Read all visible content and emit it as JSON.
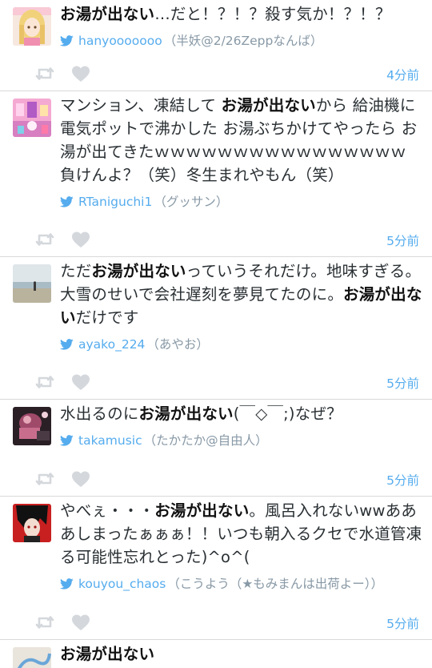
{
  "colors": {
    "link": "#55acee",
    "meta": "#8899a6",
    "icon_gray": "#d4d8dc",
    "divider": "#d9d9d9"
  },
  "tweets": [
    {
      "avatar": "anime-girl-blonde-avatar",
      "segments": [
        {
          "text": "お湯が出ない",
          "bold": true
        },
        {
          "text": "…だと！？！？殺す気か！？！？",
          "bold": false
        }
      ],
      "screen_name": "hanyooooooo",
      "display_name": "（半妖@2/26Zeppなんば）",
      "time": "4分前"
    },
    {
      "avatar": "pink-room-avatar",
      "segments": [
        {
          "text": "マンション、凍結して ",
          "bold": false
        },
        {
          "text": "お湯が出ない",
          "bold": true
        },
        {
          "text": "から 給油機に電気ポットで沸かした お湯ぶちかけてやったら お湯が出てきたｗｗｗｗｗｗｗｗｗｗｗｗｗｗｗｗ 負けんよ？（笑）冬生まれやもん（笑）",
          "bold": false
        }
      ],
      "screen_name": "RTaniguchi1",
      "display_name": "（グッサン）",
      "time": "5分前"
    },
    {
      "avatar": "beach-photo-avatar",
      "segments": [
        {
          "text": "ただ",
          "bold": false
        },
        {
          "text": "お湯が出ない",
          "bold": true
        },
        {
          "text": "っていうそれだけ。地味すぎる。大雪のせいで会社遅刻を夢見てたのに。",
          "bold": false
        },
        {
          "text": "お湯が出ない",
          "bold": true
        },
        {
          "text": "だけです",
          "bold": false
        }
      ],
      "screen_name": "ayako_224",
      "display_name": "（あやお）",
      "time": "5分前"
    },
    {
      "avatar": "concert-stage-avatar",
      "segments": [
        {
          "text": "水出るのに",
          "bold": false
        },
        {
          "text": "お湯が出ない",
          "bold": true
        },
        {
          "text": "(￣◇￣;)なぜ？",
          "bold": false
        }
      ],
      "screen_name": "takamusic",
      "display_name": "（たかたか@自由人）",
      "time": "5分前"
    },
    {
      "avatar": "anime-red-black-avatar",
      "segments": [
        {
          "text": "やべぇ・・・",
          "bold": false
        },
        {
          "text": "お湯が出ない",
          "bold": true
        },
        {
          "text": "。風呂入れないwwあああしまったぁぁぁ！！いつも朝入るクセで水道管凍る可能性忘れとった)^o^(",
          "bold": false
        }
      ],
      "screen_name": "kouyou_chaos",
      "display_name": "（こうよう（★もみまんは出荷よー））",
      "time": "5分前"
    },
    {
      "avatar": "blue-sketch-avatar",
      "segments": [
        {
          "text": "お湯が出ない",
          "bold": true
        }
      ],
      "screen_name": "",
      "display_name": "",
      "time": ""
    }
  ]
}
